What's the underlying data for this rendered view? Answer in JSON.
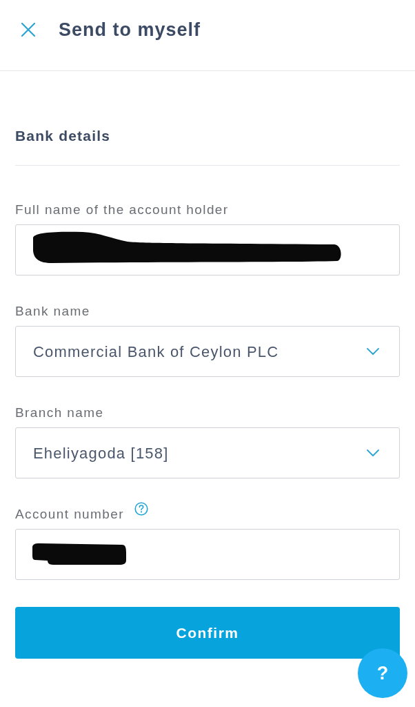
{
  "header": {
    "title": "Send to myself"
  },
  "section": {
    "title": "Bank details"
  },
  "fields": [
    {
      "kind": "text",
      "label": "Full name of the account holder",
      "redacted": true,
      "help": false
    },
    {
      "kind": "select",
      "label": "Bank name",
      "value": "Commercial Bank of Ceylon PLC",
      "redacted": false,
      "help": false
    },
    {
      "kind": "select",
      "label": "Branch name",
      "value": "Eheliyagoda [158]",
      "redacted": false,
      "help": false
    },
    {
      "kind": "text",
      "label": "Account number",
      "redacted": true,
      "help": true
    }
  ],
  "primary_button": {
    "label": "Confirm"
  },
  "help_button": {
    "label": "?"
  }
}
